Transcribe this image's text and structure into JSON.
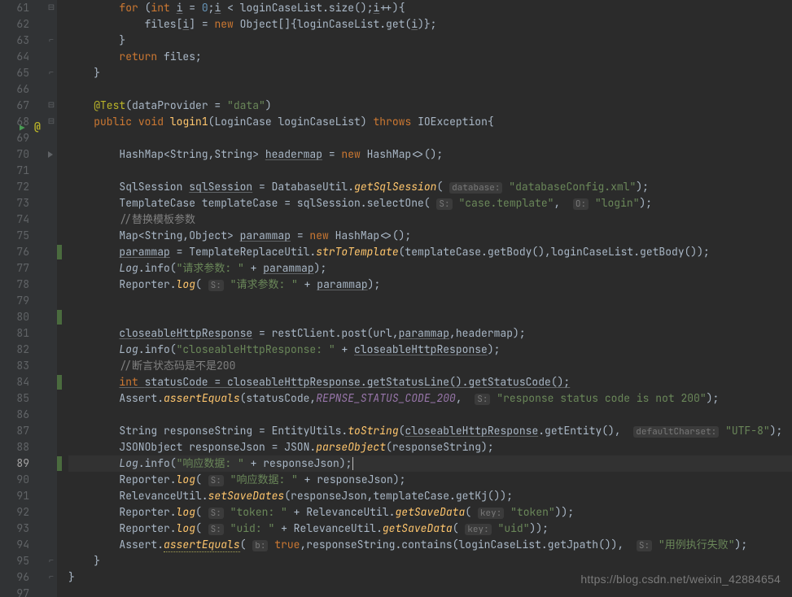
{
  "watermark": "https://blog.csdn.net/weixin_42884654",
  "gutter": {
    "start": 61,
    "end": 97,
    "current": 89
  },
  "fold_icons": {
    "61": "expand",
    "63": "collapse",
    "65": "collapse",
    "67": "region",
    "68_arrow": "run",
    "68_at": "@",
    "70": "play",
    "95": "collapse",
    "96": "collapse"
  },
  "change_marks": [
    76,
    80,
    84,
    89
  ],
  "hints": {
    "database": "database:",
    "S": "S:",
    "O": "O:",
    "b": "b:",
    "s": "s:",
    "defaultCharset": "defaultCharset:",
    "key": "key:"
  },
  "code": {
    "l61": {
      "kw_for": "for",
      "kw_int": "int",
      "v_i": "i",
      "eq": " = ",
      "zero": "0",
      "semi": ";",
      "lt": " < loginCaseList.size();",
      "inc": "++",
      "brc": "){"
    },
    "l62": {
      "a": "files[",
      "i": "i",
      "b": "] = ",
      "kw_new": "new",
      "c": " Object[]{loginCaseList.get(",
      "d": ")};"
    },
    "l63": {
      "brc": "}"
    },
    "l64": {
      "kw_ret": "return",
      "txt": " files;"
    },
    "l65": {
      "brc": "}"
    },
    "l67": {
      "ann": "@Test",
      "a": "(dataProvider = ",
      "str": "\"data\"",
      "b": ")"
    },
    "l68": {
      "kw_pub": "public",
      "kw_void": "void",
      "fn": "login1",
      "sig": "(LoginCase loginCaseList) ",
      "kw_th": "throws",
      "exc": " IOException{"
    },
    "l70": {
      "a": "HashMap<String,String> ",
      "var": "headermap",
      "b": " = ",
      "kw_new": "new",
      "c": " HashMap<>();"
    },
    "l72": {
      "a": "SqlSession ",
      "var": "sqlSession",
      "b": " = DatabaseUtil.",
      "fn": "getSqlSession",
      "c": "(",
      "str": "\"databaseConfig.xml\"",
      "d": ");"
    },
    "l73": {
      "a": "TemplateCase templateCase = sqlSession.selectOne(",
      "str1": "\"case.template\"",
      "comma": ", ",
      "str2": "\"login\"",
      "b": ");"
    },
    "l74": {
      "cmt": "//替换模板参数"
    },
    "l75": {
      "a": "Map<String,Object> ",
      "var": "parammap",
      "b": " = ",
      "kw_new": "new",
      "c": " HashMap<>();"
    },
    "l76": {
      "var": "parammap",
      "a": " = TemplateReplaceUtil.",
      "fn": "strToTemplate",
      "b": "(templateCase.getBody(),loginCaseList.getBody());"
    },
    "l77": {
      "log": "Log",
      "a": ".info(",
      "str": "\"请求参数: \"",
      "b": " + ",
      "var": "parammap",
      "c": ");"
    },
    "l78": {
      "a": "Reporter.",
      "fn": "log",
      "b": "(",
      "str": "\"请求参数: \"",
      "c": " + ",
      "var": "parammap",
      "d": ");"
    },
    "l81": {
      "var": "closeableHttpResponse",
      "a": " = restClient.post(url,",
      "var2": "parammap",
      "b": ",headermap);"
    },
    "l82": {
      "log": "Log",
      "a": ".info(",
      "str": "\"closeableHttpResponse: \"",
      "b": " + ",
      "var": "closeableHttpResponse",
      "c": ");"
    },
    "l83": {
      "cmt": "//断言状态码是不是200"
    },
    "l84": {
      "kw_int": "int ",
      "a": "statusCode = ",
      "var": "closeableHttpResponse",
      "b": ".getStatusLine().getStatusCode();"
    },
    "l85": {
      "a": "Assert.",
      "fn": "assertEquals",
      "b": "(statusCode,",
      "const": "REPNSE_STATUS_CODE_200",
      "c": ", ",
      "str": "\"response status code is not 200\"",
      "d": ");"
    },
    "l87": {
      "a": "String responseString = EntityUtils.",
      "fn": "toString",
      "b": "(",
      "var": "closeableHttpResponse",
      "c": ".getEntity(), ",
      "str": "\"UTF-8\"",
      "d": ");"
    },
    "l88": {
      "a": "JSONObject responseJson = JSON.",
      "fn": "parseObject",
      "b": "(responseString);"
    },
    "l89": {
      "log": "Log",
      "a": ".info(",
      "str": "\"响应数据: \"",
      "b": " + responseJson);"
    },
    "l90": {
      "a": "Reporter.",
      "fn": "log",
      "b": "(",
      "str": "\"响应数据: \"",
      "c": " + responseJson);"
    },
    "l91": {
      "a": "RelevanceUtil.",
      "fn": "setSaveDates",
      "b": "(responseJson,templateCase.getKj());"
    },
    "l92": {
      "a": "Reporter.",
      "fn": "log",
      "b": "(",
      "str1": "\"token: \"",
      "c": " + RelevanceUtil.",
      "fn2": "getSaveData",
      "d": "(",
      "str2": "\"token\"",
      "e": "));"
    },
    "l93": {
      "a": "Reporter.",
      "fn": "log",
      "b": "(",
      "str1": "\"uid: \"",
      "c": " + RelevanceUtil.",
      "fn2": "getSaveData",
      "d": "(",
      "str2": "\"uid\"",
      "e": "));"
    },
    "l94": {
      "a": "Assert.",
      "fn": "assertEquals",
      "b": "(",
      "kw_true": "true",
      "c": ",responseString.contains(loginCaseList.getJpath()), ",
      "str": "\"用例执行失败\"",
      "d": ");"
    },
    "l95": {
      "brc": "}"
    },
    "l96": {
      "brc": "}"
    }
  }
}
